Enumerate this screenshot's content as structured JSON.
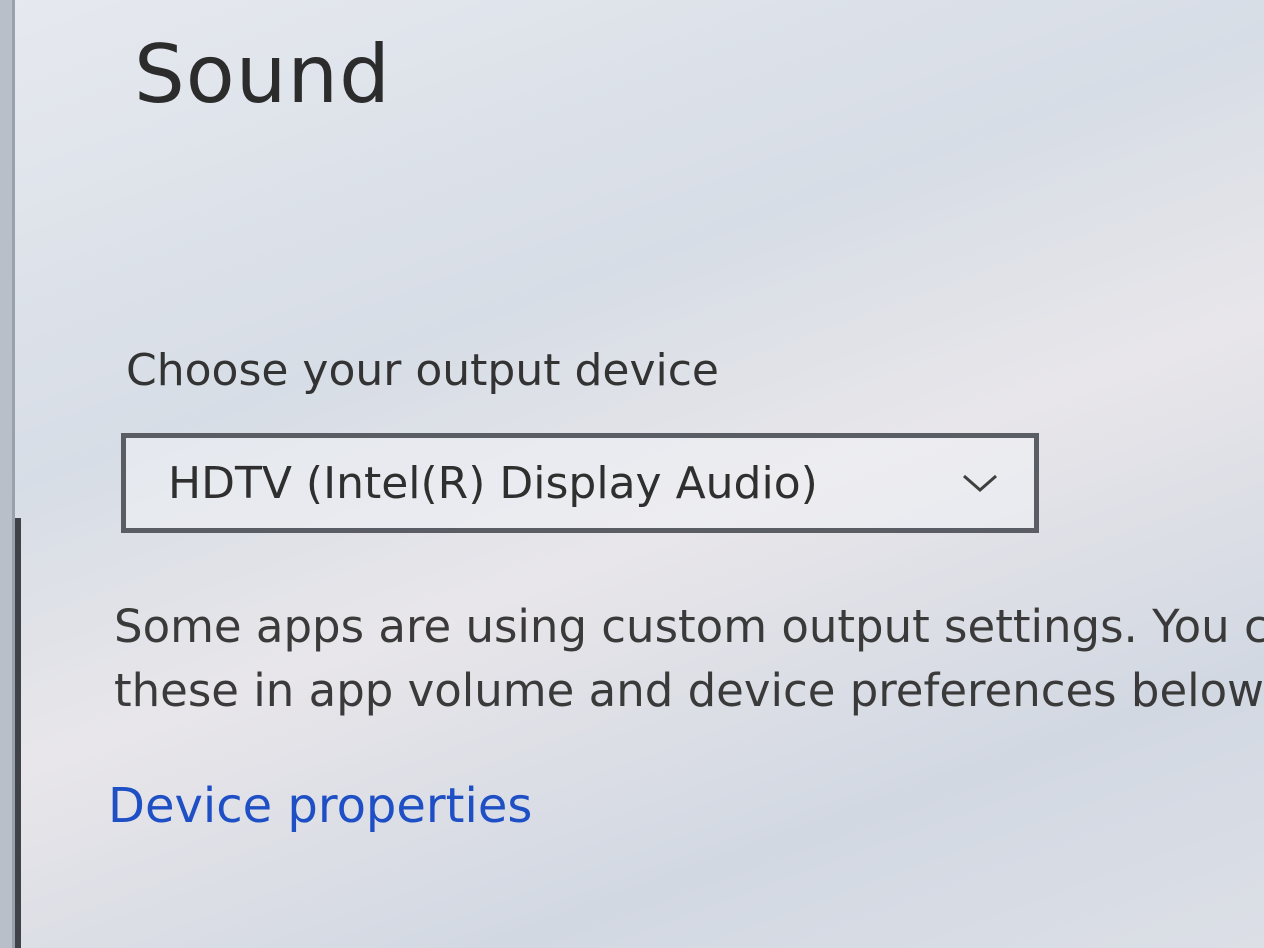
{
  "page": {
    "title": "Sound"
  },
  "output": {
    "label": "Choose your output device",
    "selected_device": "HDTV (Intel(R) Display Audio)",
    "help_line_1": "Some apps are using custom output settings. You can",
    "help_line_2": "these in app volume and device preferences below.",
    "device_properties_link": "Device properties"
  },
  "icons": {
    "dropdown": "chevron-down-icon"
  },
  "colors": {
    "link": "#1e4fc4",
    "text": "#2b2b2b"
  }
}
